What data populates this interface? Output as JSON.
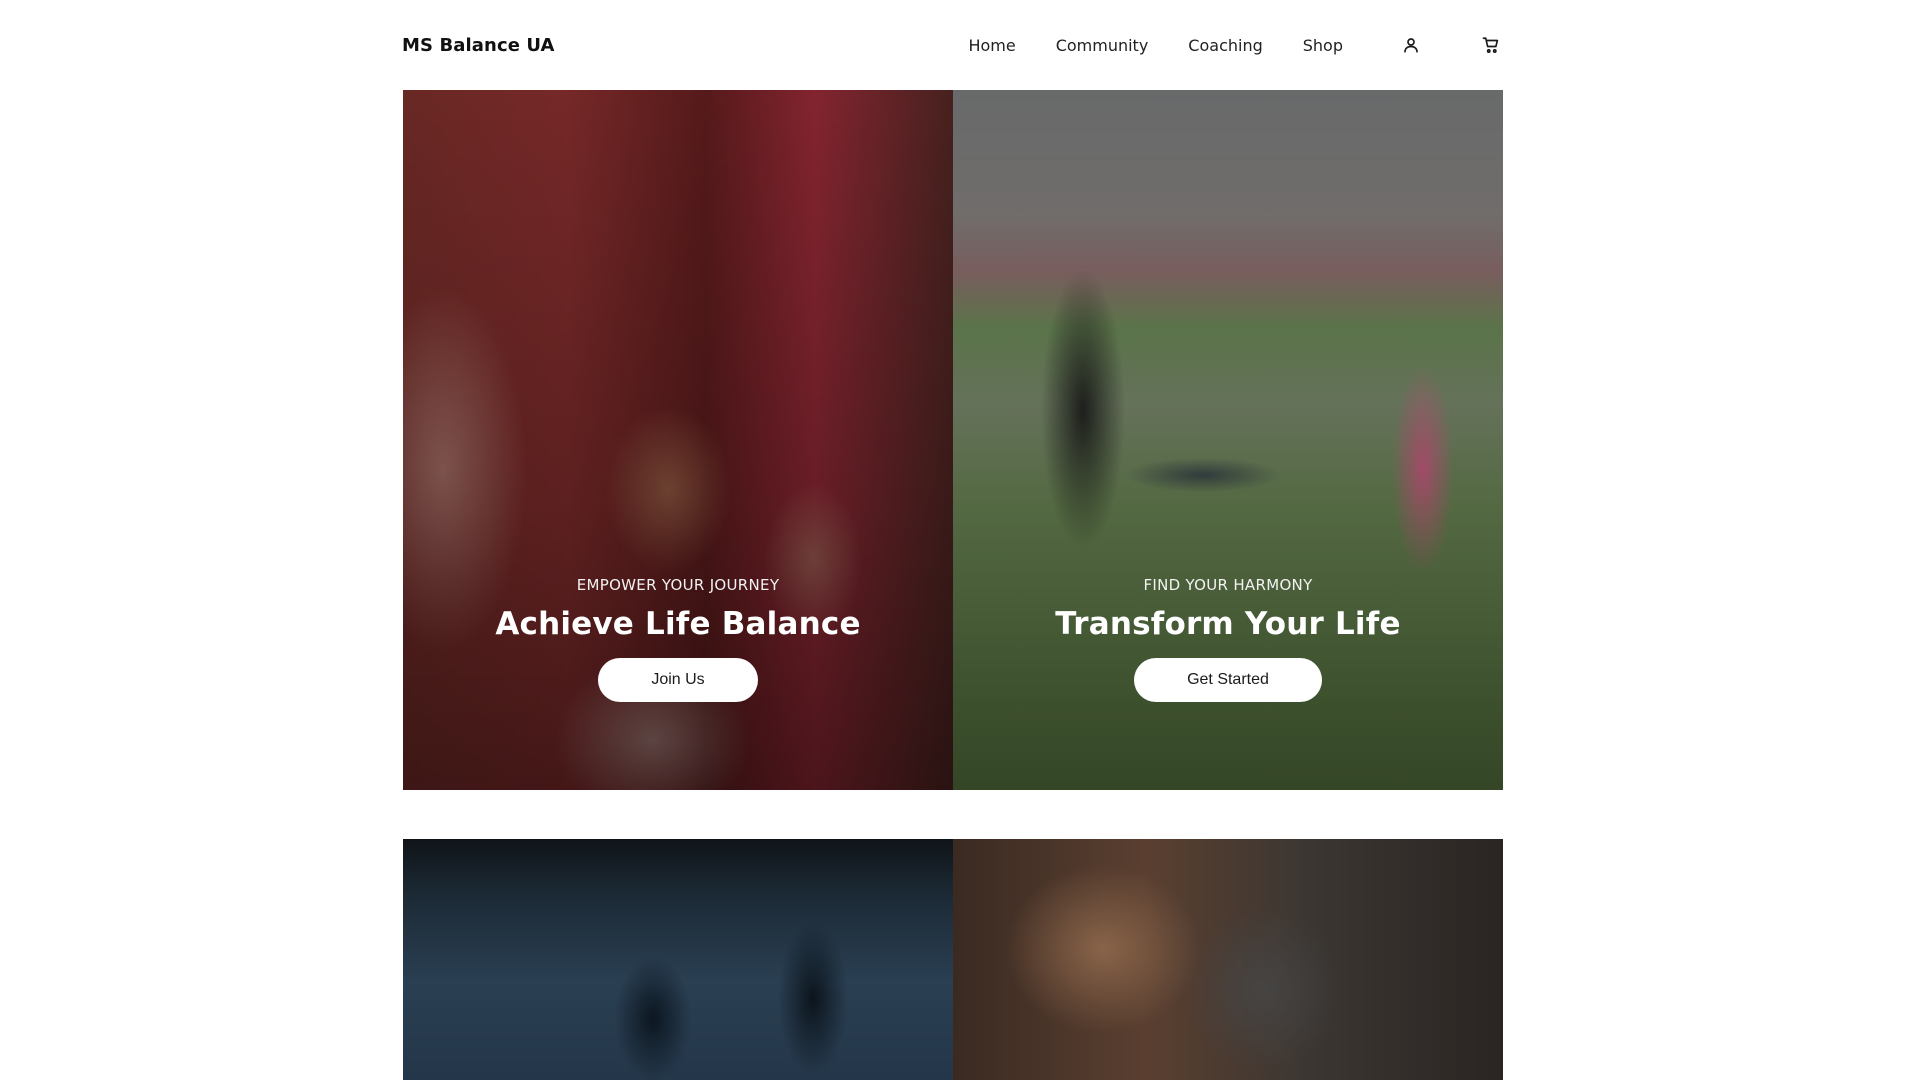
{
  "header": {
    "brand": "MS Balance UA",
    "nav": [
      "Home",
      "Community",
      "Coaching",
      "Shop"
    ],
    "icons": [
      "account-icon",
      "cart-icon"
    ]
  },
  "hero": {
    "tiles": [
      {
        "eyebrow": "EMPOWER YOUR JOURNEY",
        "title": "Achieve Life Balance",
        "button": "Join Us"
      },
      {
        "eyebrow": "FIND YOUR HARMONY",
        "title": "Transform Your Life",
        "button": "Get Started"
      }
    ]
  },
  "colors": {
    "background": "#ffffff",
    "text": "#1a1a1a",
    "button_bg": "#ffffff"
  }
}
